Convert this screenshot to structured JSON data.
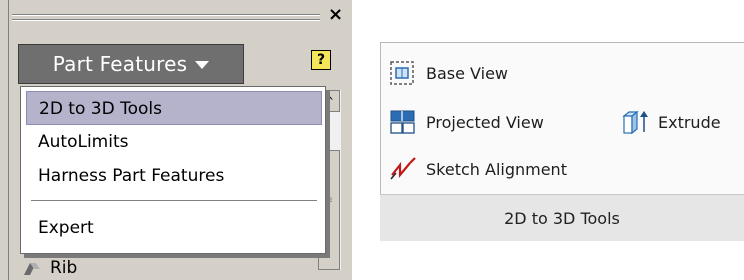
{
  "left_panel": {
    "part_features_label": "Part Features",
    "help_glyph": "?",
    "close_glyph": "×",
    "menu_items": [
      "2D to 3D Tools",
      "AutoLimits",
      "Harness Part Features",
      "Expert"
    ],
    "selected_item": "2D to 3D Tools",
    "partial_item": "Rib",
    "colors": {
      "header_bg": "#6f6f6f",
      "selected_bg": "#b5b3cc",
      "chrome": "#d4d0c8"
    }
  },
  "ribbon": {
    "buttons": {
      "base_view": "Base View",
      "projected_view": "Projected View",
      "extrude": "Extrude",
      "sketch_alignment": "Sketch Alignment"
    },
    "group_label": "2D to 3D Tools",
    "icons": [
      "base-view-icon",
      "projected-view-icon",
      "extrude-icon",
      "sketch-alignment-icon"
    ]
  }
}
